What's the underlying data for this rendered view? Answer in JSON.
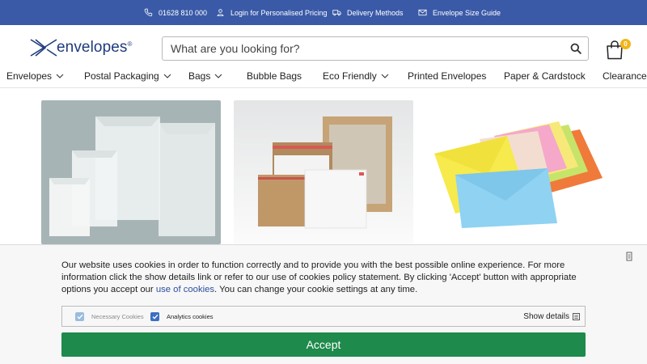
{
  "topbar": {
    "phone": "01628 810 000",
    "login": "Login for Personalised Pricing",
    "delivery": "Delivery Methods",
    "size_guide": "Envelope Size Guide"
  },
  "logo": {
    "wordmark": "envelopes",
    "reg": "®"
  },
  "search": {
    "placeholder": "What are you looking for?"
  },
  "cart": {
    "count": "0"
  },
  "nav": {
    "items": [
      {
        "label": "Envelopes",
        "dropdown": true
      },
      {
        "label": "Postal Packaging",
        "dropdown": true
      },
      {
        "label": "Bags",
        "dropdown": true
      },
      {
        "label": "Bubble Bags",
        "dropdown": false
      },
      {
        "label": "Eco Friendly",
        "dropdown": true
      },
      {
        "label": "Printed Envelopes",
        "dropdown": false
      },
      {
        "label": "Paper & Cardstock",
        "dropdown": false
      },
      {
        "label": "Clearance",
        "dropdown": false
      }
    ]
  },
  "tiles": [
    {
      "icon": "glassine-envelopes-image"
    },
    {
      "icon": "board-backed-envelopes-image"
    },
    {
      "icon": "coloured-envelopes-image"
    }
  ],
  "cookie": {
    "text_before": "Our website uses cookies in order to function correctly and to provide you with the best possible online experience. For more information click the show details link or refer to our use of cookies policy statement. By clicking 'Accept' button with appropriate options you accept our ",
    "link": "use of cookies",
    "text_after": ". You can change your cookie settings at any time.",
    "necessary_label": "Necessary Cookies",
    "analytics_label": "Analytics cookies",
    "necessary_checked": true,
    "analytics_checked": true,
    "show_details": "Show details",
    "accept": "Accept"
  },
  "colors": {
    "topbar": "#3a5aa8",
    "brand": "#1f3b7d",
    "badge": "#f3b51b",
    "accept": "#1e8a4b",
    "link": "#2c4f9e",
    "checkbox_checked": "#3a6fc4",
    "checkbox_disabled": "#9bbce0"
  }
}
